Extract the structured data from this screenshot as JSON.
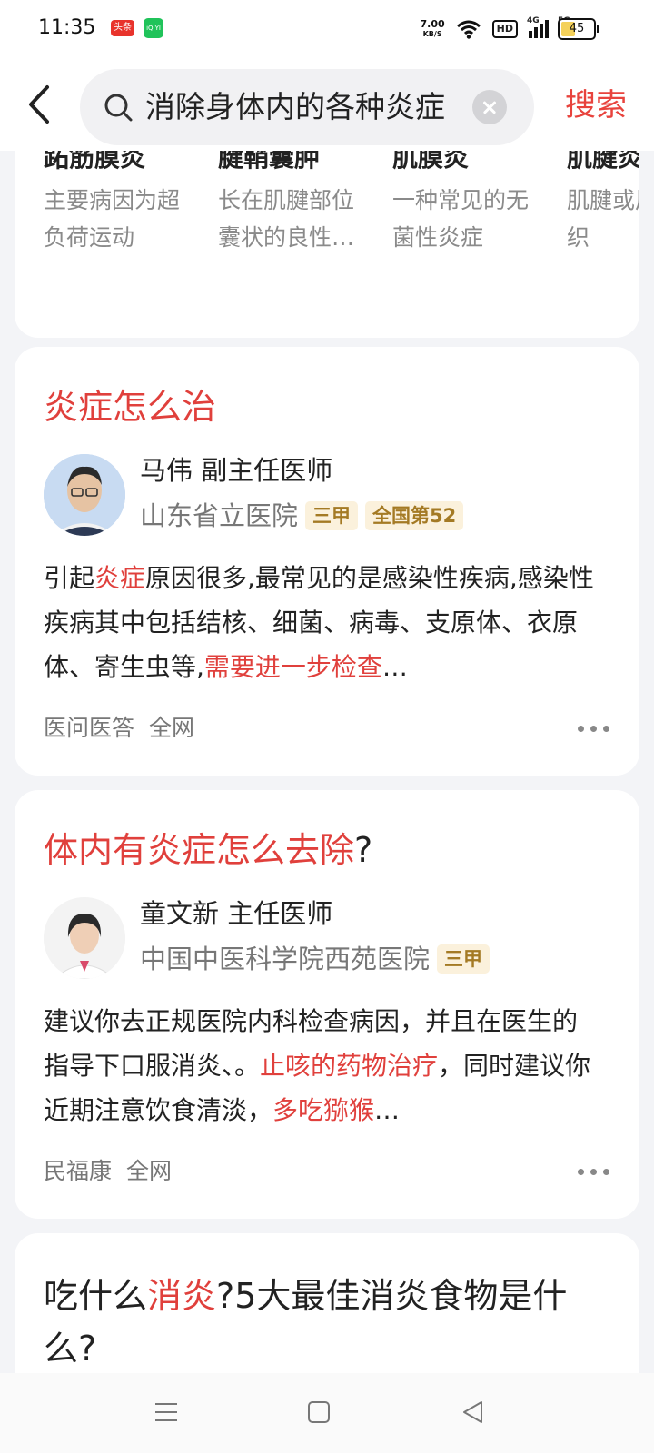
{
  "status_bar": {
    "time": "11:35",
    "app1": "头条",
    "app2": "iQIYI",
    "net_speed": "7.00",
    "net_unit": "KB/S",
    "hd": "HD",
    "sig1": "4G",
    "sig2": "5G",
    "battery": "45",
    "battery_level": 0.45
  },
  "header": {
    "search_query": "消除身体内的各种炎症",
    "search_button": "搜索"
  },
  "related": [
    {
      "title": "跖筋膜炎",
      "desc": "主要病因为超负荷运动"
    },
    {
      "title": "腱鞘囊肿",
      "desc": "长在肌腱部位囊状的良性…"
    },
    {
      "title": "肌膜炎",
      "desc": "一种常见的无菌性炎症"
    },
    {
      "title": "肌腱炎",
      "desc": "肌腱或周围组织"
    }
  ],
  "results": [
    {
      "title_hl": "炎症怎么治",
      "title_rest": "",
      "doctor": "马伟 副主任医师",
      "hospital": "山东省立医院",
      "tags": [
        "三甲",
        "全国第52"
      ],
      "answer_a": "引起",
      "answer_hl1": "炎症",
      "answer_b": "原因很多,最常见的是感染性疾病,感染性疾病其中包括结核、细菌、病毒、支原体、衣原体、寄生虫等,",
      "answer_hl2": "需要进一步检查",
      "answer_ell": "…",
      "source": "医问医答",
      "scope": "全网"
    },
    {
      "title_hl": "体内有炎症怎么去除",
      "title_rest": "?",
      "doctor": "童文新 主任医师",
      "hospital": "中国中医科学院西苑医院",
      "tags": [
        "三甲"
      ],
      "answer_a": "建议你去正规医院内科检查病因，并且在医生的指导下口服消炎、。",
      "answer_hl1": "止咳的药物治疗",
      "answer_b": "，同时建议你近期注意饮食清淡，",
      "answer_hl2": "多吃猕猴",
      "answer_ell": "…",
      "source": "民福康",
      "scope": "全网"
    },
    {
      "title_a": "吃什么",
      "title_hl": "消炎",
      "title_b": "?5大最佳消炎食物是什么?"
    }
  ]
}
